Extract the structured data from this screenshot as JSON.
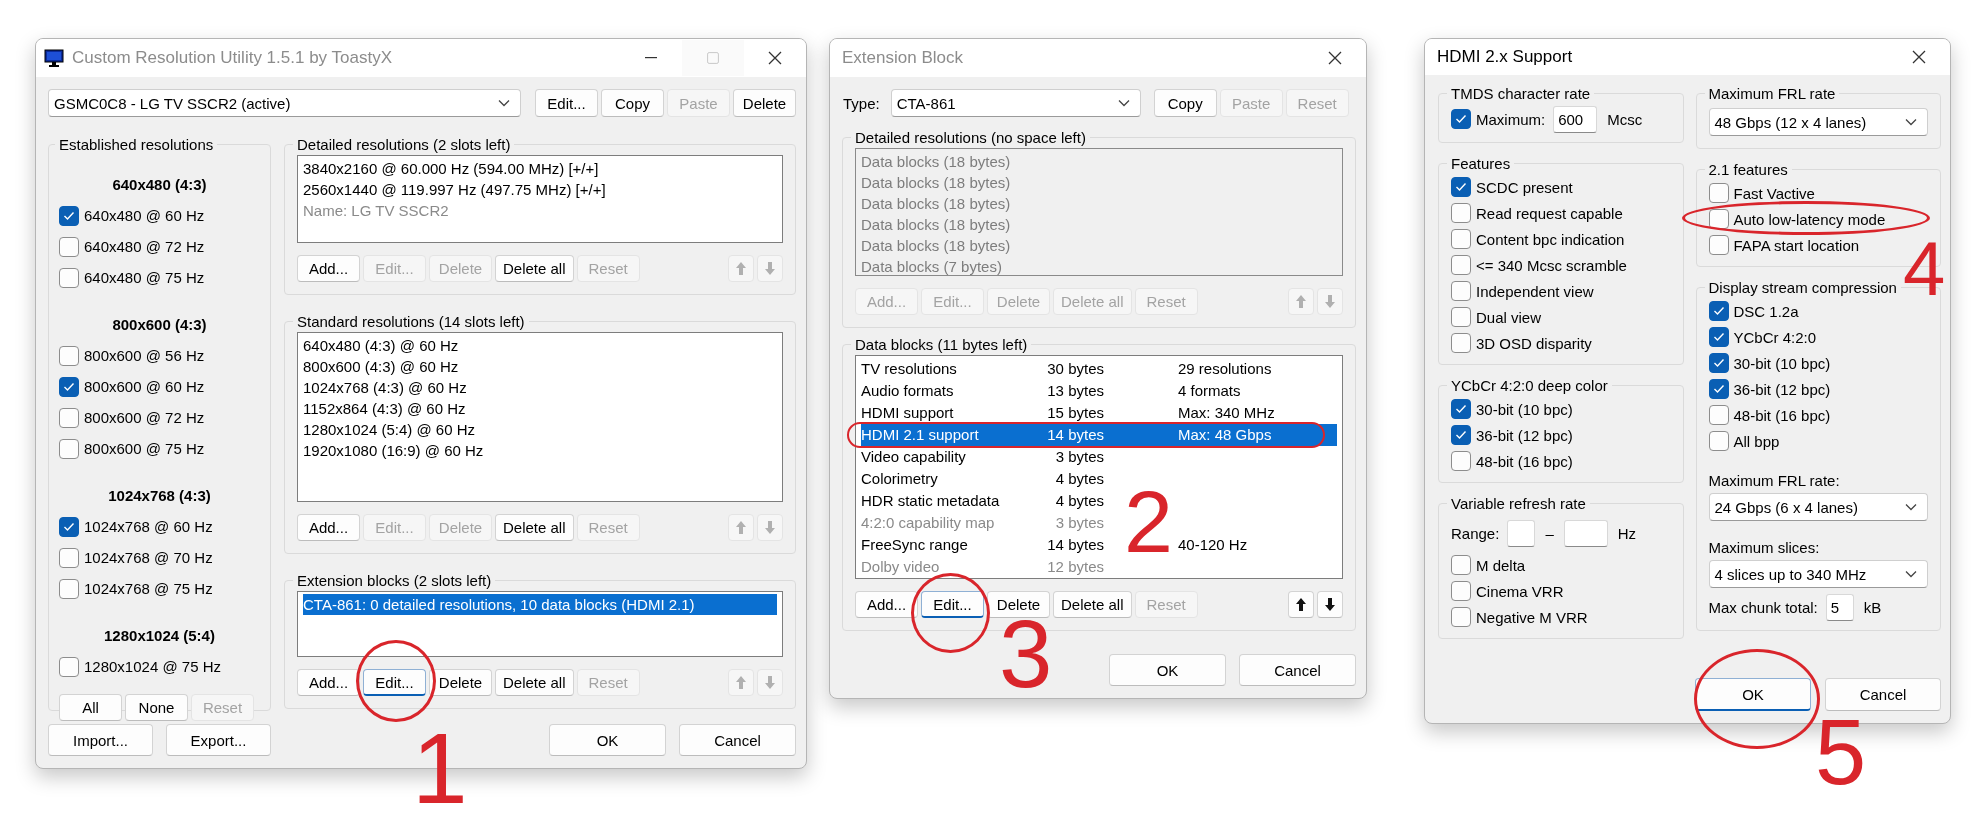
{
  "cru_window": {
    "title": "Custom Resolution Utility 1.5.1 by ToastyX",
    "active": false,
    "has_app_icon": true,
    "window_controls": [
      {
        "kind": "minimize",
        "disabled": false
      },
      {
        "kind": "maximize",
        "disabled": true
      },
      {
        "kind": "close",
        "disabled": false
      }
    ],
    "monitor": "GSMC0C8 - LG TV SSCR2 (active)",
    "monitor_buttons": [
      {
        "label": "Edit...",
        "disabled": false
      },
      {
        "label": "Copy",
        "disabled": false
      },
      {
        "label": "Paste",
        "disabled": true
      },
      {
        "label": "Delete",
        "disabled": false
      }
    ],
    "established": {
      "title": "Established resolutions",
      "controls": [
        {
          "kind": "heading",
          "text": "640x480 (4:3)"
        },
        {
          "kind": "checkbox",
          "label": "640x480 @ 60 Hz",
          "checked": true
        },
        {
          "kind": "checkbox",
          "label": "640x480 @ 72 Hz",
          "checked": false
        },
        {
          "kind": "checkbox",
          "label": "640x480 @ 75 Hz",
          "checked": false
        },
        {
          "kind": "heading",
          "text": "800x600 (4:3)"
        },
        {
          "kind": "checkbox",
          "label": "800x600 @ 56 Hz",
          "checked": false
        },
        {
          "kind": "checkbox",
          "label": "800x600 @ 60 Hz",
          "checked": true
        },
        {
          "kind": "checkbox",
          "label": "800x600 @ 72 Hz",
          "checked": false
        },
        {
          "kind": "checkbox",
          "label": "800x600 @ 75 Hz",
          "checked": false
        },
        {
          "kind": "heading",
          "text": "1024x768 (4:3)"
        },
        {
          "kind": "checkbox",
          "label": "1024x768 @ 60 Hz",
          "checked": true
        },
        {
          "kind": "checkbox",
          "label": "1024x768 @ 70 Hz",
          "checked": false
        },
        {
          "kind": "checkbox",
          "label": "1024x768 @ 75 Hz",
          "checked": false
        },
        {
          "kind": "heading",
          "text": "1280x1024 (5:4)"
        },
        {
          "kind": "checkbox",
          "label": "1280x1024 @ 75 Hz",
          "checked": false
        }
      ],
      "buttons": [
        {
          "label": "All",
          "disabled": false
        },
        {
          "label": "None",
          "disabled": false
        },
        {
          "label": "Reset",
          "disabled": true
        }
      ]
    },
    "panels": [
      {
        "title": "Detailed resolutions (2 slots left)",
        "items": [
          {
            "cells": [
              "3840x2160 @ 60.000 Hz (594.00 MHz) [+/+]"
            ],
            "selected": false,
            "dimmed": false
          },
          {
            "cells": [
              "2560x1440 @ 119.997 Hz (497.75 MHz) [+/+]"
            ],
            "selected": false,
            "dimmed": false
          },
          {
            "cells": [
              "Name: LG TV SSCR2"
            ],
            "selected": false,
            "dimmed": true
          }
        ],
        "buttons": [
          {
            "label": "Add...",
            "disabled": false
          },
          {
            "label": "Edit...",
            "disabled": true
          },
          {
            "label": "Delete",
            "disabled": true
          },
          {
            "label": "Delete all",
            "disabled": false
          },
          {
            "label": "Reset",
            "disabled": true
          }
        ],
        "arrows_disabled": true
      },
      {
        "title": "Standard resolutions (14 slots left)",
        "items": [
          {
            "cells": [
              "640x480 (4:3) @ 60 Hz"
            ],
            "selected": false
          },
          {
            "cells": [
              "800x600 (4:3) @ 60 Hz"
            ],
            "selected": false
          },
          {
            "cells": [
              "1024x768 (4:3) @ 60 Hz"
            ],
            "selected": false
          },
          {
            "cells": [
              "1152x864 (4:3) @ 60 Hz"
            ],
            "selected": false
          },
          {
            "cells": [
              "1280x1024 (5:4) @ 60 Hz"
            ],
            "selected": false
          },
          {
            "cells": [
              "1920x1080 (16:9) @ 60 Hz"
            ],
            "selected": false
          }
        ],
        "buttons": [
          {
            "label": "Add...",
            "disabled": false
          },
          {
            "label": "Edit...",
            "disabled": true
          },
          {
            "label": "Delete",
            "disabled": true
          },
          {
            "label": "Delete all",
            "disabled": false
          },
          {
            "label": "Reset",
            "disabled": true
          }
        ],
        "arrows_disabled": true
      },
      {
        "title": "Extension blocks (2 slots left)",
        "items": [
          {
            "cells": [
              "CTA-861: 0 detailed resolutions, 10 data blocks (HDMI 2.1)"
            ],
            "selected": true
          }
        ],
        "buttons": [
          {
            "label": "Add...",
            "disabled": false,
            "focused": false
          },
          {
            "label": "Edit...",
            "disabled": false,
            "focused": true
          },
          {
            "label": "Delete",
            "disabled": false,
            "focused": false
          },
          {
            "label": "Delete all",
            "disabled": false,
            "focused": false
          },
          {
            "label": "Reset",
            "disabled": true,
            "focused": false
          }
        ],
        "arrows_disabled": true
      }
    ],
    "footer_left": [
      {
        "label": "Import...",
        "disabled": false
      },
      {
        "label": "Export...",
        "disabled": false
      }
    ],
    "footer_right": [
      {
        "label": "OK",
        "disabled": false
      },
      {
        "label": "Cancel",
        "disabled": false
      }
    ]
  },
  "extension_window": {
    "title": "Extension Block",
    "active": false,
    "window_controls": [
      {
        "kind": "close",
        "disabled": false
      }
    ],
    "type_label": "Type:",
    "type": "CTA-861",
    "buttons": [
      {
        "label": "Copy",
        "disabled": false
      },
      {
        "label": "Paste",
        "disabled": true
      },
      {
        "label": "Reset",
        "disabled": true
      }
    ],
    "panels": [
      {
        "title": "Detailed resolutions (no space left)",
        "disabled": true,
        "items": [
          {
            "cells": [
              "Data blocks (18 bytes)"
            ],
            "selected": false
          },
          {
            "cells": [
              "Data blocks (18 bytes)"
            ],
            "selected": false
          },
          {
            "cells": [
              "Data blocks (18 bytes)"
            ],
            "selected": false
          },
          {
            "cells": [
              "Data blocks (18 bytes)"
            ],
            "selected": false
          },
          {
            "cells": [
              "Data blocks (18 bytes)"
            ],
            "selected": false
          },
          {
            "cells": [
              "Data blocks (7 bytes)"
            ],
            "selected": false
          }
        ],
        "buttons": [
          {
            "label": "Add...",
            "disabled": true
          },
          {
            "label": "Edit...",
            "disabled": true
          },
          {
            "label": "Delete",
            "disabled": true
          },
          {
            "label": "Delete all",
            "disabled": true
          },
          {
            "label": "Reset",
            "disabled": true
          }
        ],
        "arrows_disabled": true
      },
      {
        "title": "Data blocks (11 bytes left)",
        "disabled": false,
        "items": [
          {
            "cells": [
              "TV resolutions",
              "30 bytes",
              "29 resolutions"
            ],
            "selected": false,
            "dimmed": false
          },
          {
            "cells": [
              "Audio formats",
              "13 bytes",
              "4 formats"
            ],
            "selected": false,
            "dimmed": false
          },
          {
            "cells": [
              "HDMI support",
              "15 bytes",
              "Max: 340 MHz"
            ],
            "selected": false,
            "dimmed": false
          },
          {
            "cells": [
              "HDMI 2.1 support",
              "14 bytes",
              "Max: 48 Gbps"
            ],
            "selected": true,
            "dimmed": false
          },
          {
            "cells": [
              "Video capability",
              "3 bytes"
            ],
            "selected": false,
            "dimmed": false
          },
          {
            "cells": [
              "Colorimetry",
              "4 bytes"
            ],
            "selected": false,
            "dimmed": false
          },
          {
            "cells": [
              "HDR static metadata",
              "4 bytes"
            ],
            "selected": false,
            "dimmed": false
          },
          {
            "cells": [
              "4:2:0 capability map",
              "3 bytes"
            ],
            "selected": false,
            "dimmed": true
          },
          {
            "cells": [
              "FreeSync range",
              "14 bytes",
              "40-120 Hz"
            ],
            "selected": false,
            "dimmed": false
          },
          {
            "cells": [
              "Dolby video",
              "12 bytes"
            ],
            "selected": false,
            "dimmed": true
          }
        ],
        "buttons": [
          {
            "label": "Add...",
            "disabled": false,
            "focused": false
          },
          {
            "label": "Edit...",
            "disabled": false,
            "focused": true
          },
          {
            "label": "Delete",
            "disabled": false,
            "focused": false
          },
          {
            "label": "Delete all",
            "disabled": false,
            "focused": false
          },
          {
            "label": "Reset",
            "disabled": true,
            "focused": false
          }
        ],
        "arrows_disabled": false
      }
    ],
    "footer_right": [
      {
        "label": "OK",
        "disabled": false
      },
      {
        "label": "Cancel",
        "disabled": false
      }
    ]
  },
  "hdmi_window": {
    "title": "HDMI 2.x Support",
    "active": true,
    "window_controls": [
      {
        "kind": "close",
        "disabled": false
      }
    ],
    "left_groups": [
      {
        "title": "TMDS character rate",
        "controls": [
          {
            "kind": "checkbox_field",
            "label": "Maximum:",
            "checked": true,
            "value": "600",
            "unit": "Mcsc"
          }
        ]
      },
      {
        "title": "Features",
        "controls": [
          {
            "kind": "checkbox",
            "label": "SCDC present",
            "checked": true
          },
          {
            "kind": "checkbox",
            "label": "Read request capable",
            "checked": false
          },
          {
            "kind": "checkbox",
            "label": "Content bpc indication",
            "checked": false
          },
          {
            "kind": "checkbox",
            "label": "<= 340 Mcsc scramble",
            "checked": false
          },
          {
            "kind": "checkbox",
            "label": "Independent view",
            "checked": false
          },
          {
            "kind": "checkbox",
            "label": "Dual view",
            "checked": false
          },
          {
            "kind": "checkbox",
            "label": "3D OSD disparity",
            "checked": false
          }
        ]
      },
      {
        "title": "YCbCr 4:2:0 deep color",
        "controls": [
          {
            "kind": "checkbox",
            "label": "30-bit (10 bpc)",
            "checked": true
          },
          {
            "kind": "checkbox",
            "label": "36-bit (12 bpc)",
            "checked": true
          },
          {
            "kind": "checkbox",
            "label": "48-bit (16 bpc)",
            "checked": false
          }
        ]
      },
      {
        "title": "Variable refresh rate",
        "controls": [
          {
            "kind": "range",
            "label": "Range:",
            "separator": "–",
            "unit": "Hz"
          },
          {
            "kind": "checkbox",
            "label": "M delta",
            "checked": false
          },
          {
            "kind": "checkbox",
            "label": "Cinema VRR",
            "checked": false
          },
          {
            "kind": "checkbox",
            "label": "Negative M VRR",
            "checked": false
          }
        ]
      }
    ],
    "right_groups": [
      {
        "title": "Maximum FRL rate",
        "controls": [
          {
            "kind": "select",
            "value": "48 Gbps (12 x 4 lanes)"
          }
        ]
      },
      {
        "title": "2.1 features",
        "controls": [
          {
            "kind": "checkbox",
            "label": "Fast Vactive",
            "checked": false
          },
          {
            "kind": "checkbox",
            "label": "Auto low-latency mode",
            "checked": false
          },
          {
            "kind": "checkbox",
            "label": "FAPA start location",
            "checked": false
          }
        ]
      },
      {
        "title": "Display stream compression",
        "controls": [
          {
            "kind": "checkbox",
            "label": "DSC 1.2a",
            "checked": true
          },
          {
            "kind": "checkbox",
            "label": "YCbCr 4:2:0",
            "checked": true
          },
          {
            "kind": "checkbox",
            "label": "30-bit (10 bpc)",
            "checked": true
          },
          {
            "kind": "checkbox",
            "label": "36-bit (12 bpc)",
            "checked": true
          },
          {
            "kind": "checkbox",
            "label": "48-bit (16 bpc)",
            "checked": false
          },
          {
            "kind": "checkbox",
            "label": "All bpp",
            "checked": false
          },
          {
            "kind": "caption",
            "text": "Maximum FRL rate:"
          },
          {
            "kind": "select",
            "value": "24 Gbps (6 x 4 lanes)"
          },
          {
            "kind": "caption",
            "text": "Maximum slices:"
          },
          {
            "kind": "select",
            "value": "4 slices up to 340 MHz"
          },
          {
            "kind": "field",
            "label": "Max chunk total:",
            "value": "5",
            "unit": "kB"
          }
        ]
      }
    ],
    "footer_right": [
      {
        "label": "OK",
        "disabled": false,
        "focused": true
      },
      {
        "label": "Cancel",
        "disabled": false,
        "focused": false
      }
    ]
  },
  "annotations": [
    {
      "number": "1"
    },
    {
      "number": "2"
    },
    {
      "number": "3"
    },
    {
      "number": "4"
    },
    {
      "number": "5"
    }
  ]
}
